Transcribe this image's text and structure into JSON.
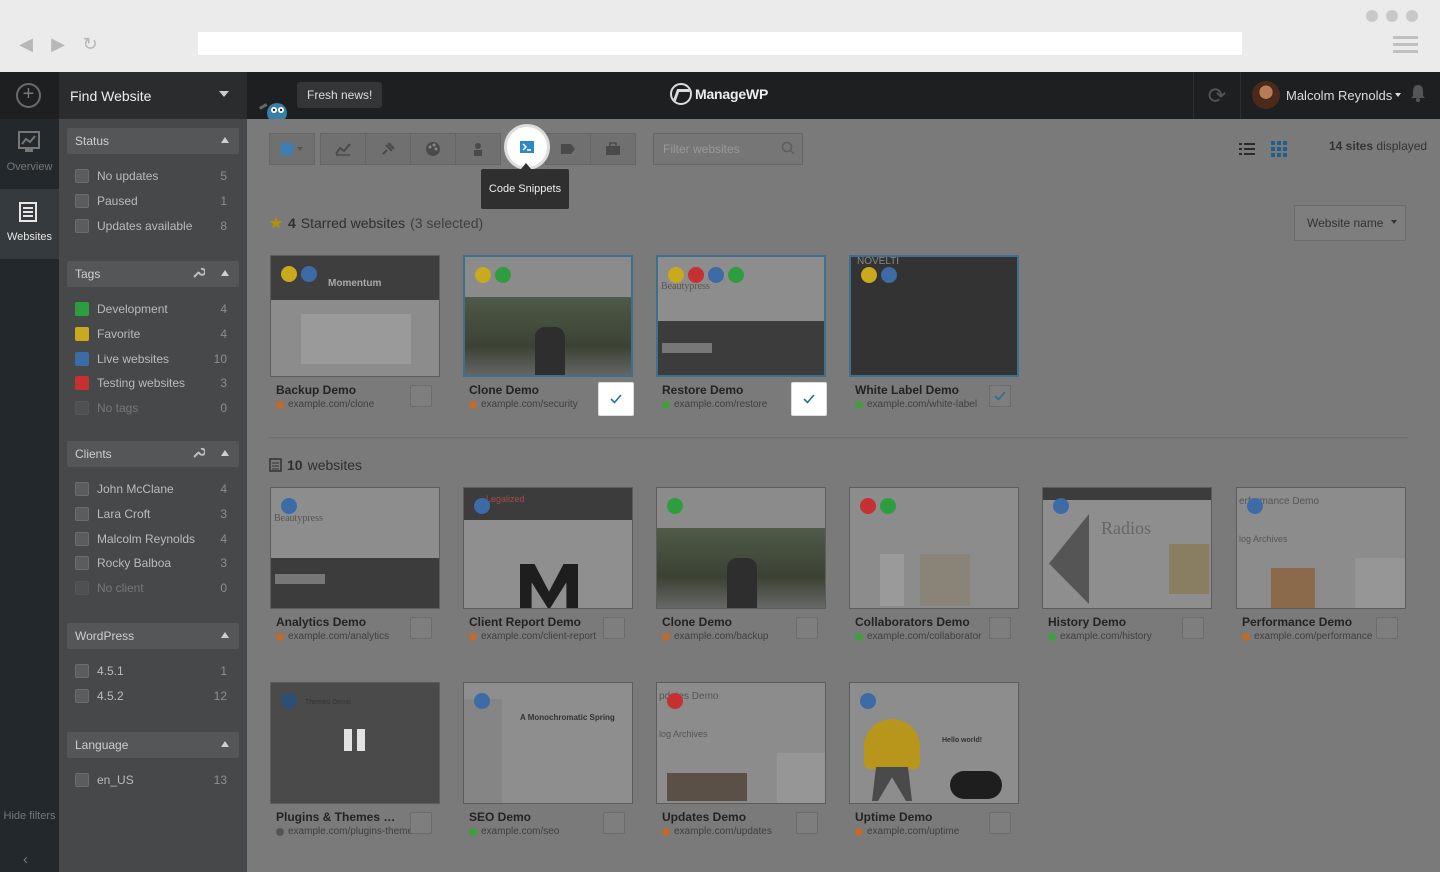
{
  "header": {
    "find_website": "Find Website",
    "fresh_news": "Fresh news!",
    "logo": "ManageWP",
    "user_name": "Malcolm Reynolds"
  },
  "rail": {
    "overview": "Overview",
    "websites": "Websites",
    "hide_filters": "Hide filters"
  },
  "filters": {
    "status": {
      "title": "Status",
      "items": [
        {
          "label": "No updates",
          "count": "5"
        },
        {
          "label": "Paused",
          "count": "1"
        },
        {
          "label": "Updates available",
          "count": "8"
        }
      ]
    },
    "tags": {
      "title": "Tags",
      "items": [
        {
          "label": "Development",
          "count": "4",
          "color": "#2e9d3f"
        },
        {
          "label": "Favorite",
          "count": "4",
          "color": "#c9a91e"
        },
        {
          "label": "Live websites",
          "count": "10",
          "color": "#3d6ba6"
        },
        {
          "label": "Testing websites",
          "count": "3",
          "color": "#c53030"
        },
        {
          "label": "No tags",
          "count": "0"
        }
      ]
    },
    "clients": {
      "title": "Clients",
      "items": [
        {
          "label": "John McClane",
          "count": "4"
        },
        {
          "label": "Lara Croft",
          "count": "3"
        },
        {
          "label": "Malcolm Reynolds",
          "count": "4"
        },
        {
          "label": "Rocky Balboa",
          "count": "3"
        },
        {
          "label": "No client",
          "count": "0"
        }
      ]
    },
    "wordpress": {
      "title": "WordPress",
      "items": [
        {
          "label": "4.5.1",
          "count": "1"
        },
        {
          "label": "4.5.2",
          "count": "12"
        }
      ]
    },
    "language": {
      "title": "Language",
      "items": [
        {
          "label": "en_US",
          "count": "13"
        }
      ]
    }
  },
  "toolbar": {
    "tooltip": "Code Snippets",
    "filter_placeholder": "Filter websites",
    "sites_count": "14 sites",
    "sites_suffix": "displayed"
  },
  "sections": {
    "starred_count": "4",
    "starred_label": "Starred websites",
    "starred_selected": "(3 selected)",
    "all_count": "10",
    "all_label": "websites"
  },
  "sort": {
    "selected": "Website name"
  },
  "starred_sites": [
    {
      "name": "Backup Demo",
      "url": "example.com/clone",
      "fav": "#c06a2b",
      "checked": false,
      "white": false,
      "wm": "Momentum"
    },
    {
      "name": "Clone Demo",
      "url": "example.com/security",
      "fav": "#c06a2b",
      "checked": true,
      "white": true
    },
    {
      "name": "Restore Demo",
      "url": "example.com/restore",
      "fav": "#3f9f3a",
      "checked": true,
      "white": true,
      "wm": "Beautypress"
    },
    {
      "name": "White Label Demo",
      "url": "example.com/white-label",
      "fav": "#3f9f3a",
      "checked": true,
      "white": false,
      "wm": "NOVELTI"
    }
  ],
  "sites": [
    {
      "name": "Analytics Demo",
      "url": "example.com/analytics",
      "fav": "#c06a2b",
      "wm": "Beautypress"
    },
    {
      "name": "Client Report Demo",
      "url": "example.com/client-report",
      "fav": "#c06a2b",
      "wm": "Legalized"
    },
    {
      "name": "Clone Demo",
      "url": "example.com/backup",
      "fav": "#c06a2b"
    },
    {
      "name": "Collaborators Demo",
      "url": "example.com/collaborator",
      "fav": "#3f9f3a"
    },
    {
      "name": "History Demo",
      "url": "example.com/history",
      "fav": "#3f9f3a",
      "wm": "Radios"
    },
    {
      "name": "Performance Demo",
      "url": "example.com/performance",
      "fav": "#c06a2b",
      "wm": "erformance Demo",
      "wm2": "log Archives"
    },
    {
      "name": "Plugins & Themes Dem...",
      "url": "example.com/plugins-theme",
      "fav": "#555",
      "wm": "Themes Demo"
    },
    {
      "name": "SEO Demo",
      "url": "example.com/seo",
      "fav": "#3f9f3a",
      "wm": "A Monochromatic Spring"
    },
    {
      "name": "Updates Demo",
      "url": "example.com/updates",
      "fav": "#c06a2b",
      "wm": "pdates Demo",
      "wm2": "log Archives"
    },
    {
      "name": "Uptime Demo",
      "url": "example.com/uptime",
      "fav": "#c06a2b",
      "wm": "Hello world!"
    }
  ]
}
